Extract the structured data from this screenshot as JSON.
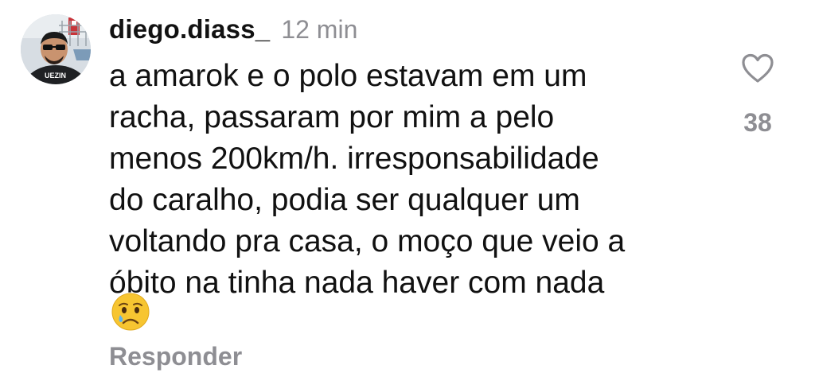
{
  "comment": {
    "username": "diego.diass_",
    "timestamp": "12 min",
    "text_lines": [
      "a amarok e o polo estavam em um",
      "racha, passaram por mim a pelo",
      "menos 200km/h. irresponsabilidade",
      "do caralho, podia ser qualquer um",
      "voltando pra casa, o moço que veio a",
      "óbito na tinha nada haver com nada"
    ],
    "emoji": "crying-face-emoji",
    "reply_label": "Responder",
    "like_count": "38",
    "like_icon": "heart-outline-icon",
    "colors": {
      "text": "#111111",
      "muted": "#8e8e93",
      "background": "#ffffff"
    }
  }
}
